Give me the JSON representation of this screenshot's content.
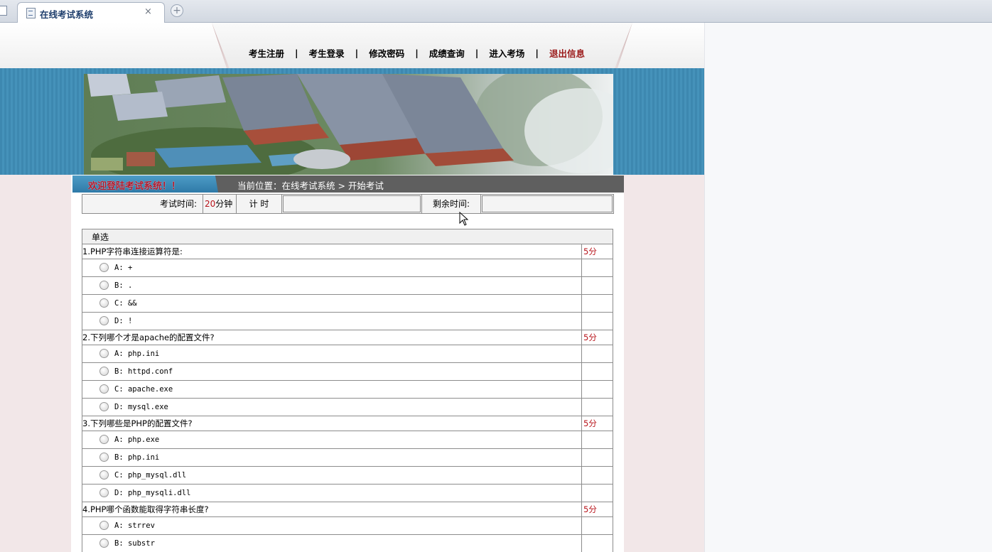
{
  "browser": {
    "tab_title": "在线考试系统",
    "tab_close": "×",
    "new_tab": "+"
  },
  "nav": {
    "items": [
      "考生注册",
      "考生登录",
      "修改密码",
      "成绩查询",
      "进入考场",
      "退出信息"
    ],
    "separator": "|",
    "colors": {
      "normal": "#000000",
      "exit": "#9b1b1b"
    }
  },
  "banner": {
    "welcome": "欢迎登陆考试系统！！",
    "location": "当前位置：在线考试系统 > 开始考试"
  },
  "timer": {
    "exam_time_label": "考试时间:",
    "exam_time_value": "20",
    "exam_time_unit": "分钟",
    "timer_label": "计 时",
    "timer_value": "",
    "remain_label": "剩余时间:",
    "remain_value": ""
  },
  "exam": {
    "section": "单选",
    "questions": [
      {
        "text": "1.PHP字符串连接运算符是:",
        "score": "5分",
        "options": [
          "A: +",
          "B: .",
          "C: &&",
          "D: !"
        ]
      },
      {
        "text": "2.下列哪个才是apache的配置文件?",
        "score": "5分",
        "options": [
          "A: php.ini",
          "B: httpd.conf",
          "C: apache.exe",
          "D: mysql.exe"
        ]
      },
      {
        "text": "3.下列哪些是PHP的配置文件?",
        "score": "5分",
        "options": [
          "A: php.exe",
          "B: php.ini",
          "C: php_mysql.dll",
          "D: php_mysqli.dll"
        ]
      },
      {
        "text": "4.PHP哪个函数能取得字符串长度?",
        "score": "5分",
        "options": [
          "A: strrev",
          "B: substr"
        ]
      }
    ]
  },
  "colors": {
    "accent_blue": "#3d88b0",
    "score_red": "#b8141b",
    "welcome_red": "#b2182b"
  }
}
